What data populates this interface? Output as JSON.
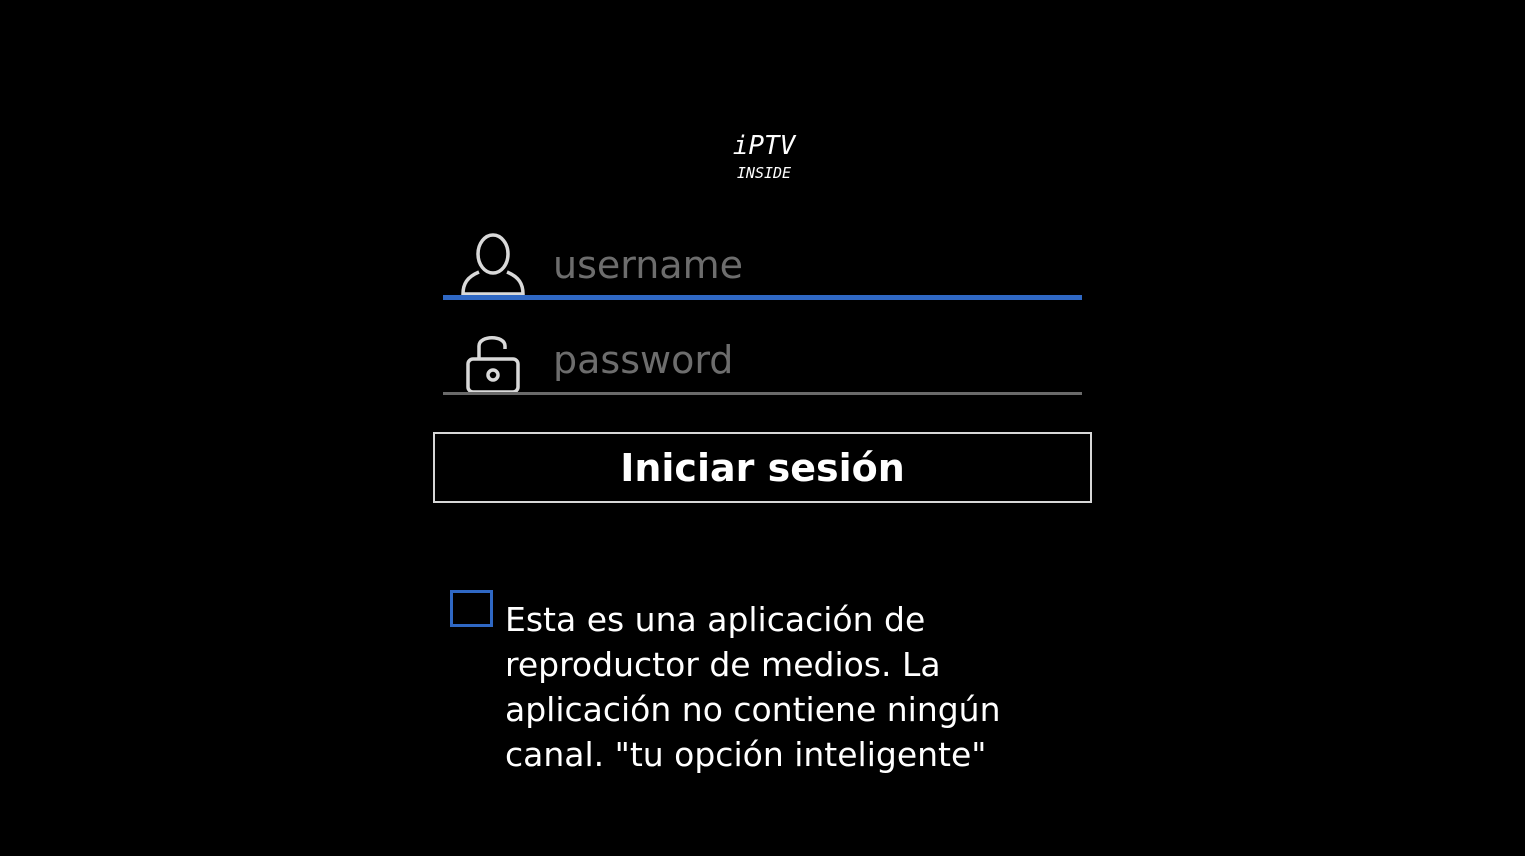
{
  "logo": {
    "line1": "iPTV",
    "line2": "INSIDE",
    "icon": "iptv-inside-logo"
  },
  "login": {
    "username_placeholder": "username",
    "username_value": "",
    "password_placeholder": "password",
    "password_value": "",
    "submit_label": "Iniciar sesión"
  },
  "disclaimer": {
    "checked": false,
    "text": "Esta es una aplicación de reproductor de medios. La aplicación no contiene ningún canal. \"tu opción inteligente\""
  },
  "colors": {
    "background": "#000000",
    "accent": "#2f68c4",
    "text": "#ffffff",
    "placeholder": "#6d6d6d"
  },
  "icons": {
    "user": "user-icon",
    "lock": "unlock-icon"
  }
}
